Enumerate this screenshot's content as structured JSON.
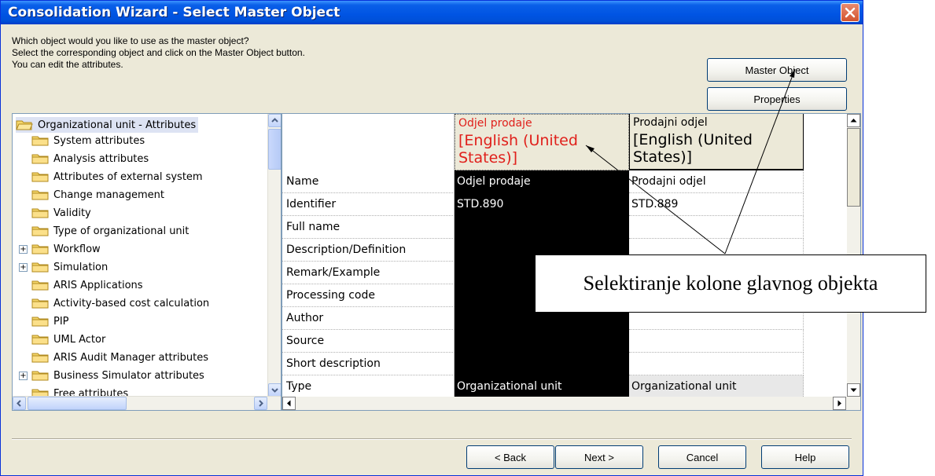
{
  "window": {
    "title": "Consolidation Wizard - Select Master Object"
  },
  "intro": {
    "line1": "Which object would you like to use as the master object?",
    "line2": "Select the corresponding object and click on the Master Object button.",
    "line3": "You can edit the attributes."
  },
  "buttons": {
    "master_object": "Master Object",
    "properties": "Properties",
    "back": "< Back",
    "next": "Next >",
    "cancel": "Cancel",
    "help": "Help"
  },
  "tree": {
    "root": "Organizational unit - Attributes",
    "items": [
      {
        "label": "System attributes",
        "expandable": false
      },
      {
        "label": "Analysis attributes",
        "expandable": false
      },
      {
        "label": "Attributes of external system",
        "expandable": false
      },
      {
        "label": "Change management",
        "expandable": false
      },
      {
        "label": "Validity",
        "expandable": false
      },
      {
        "label": "Type of organizational unit",
        "expandable": false
      },
      {
        "label": "Workflow",
        "expandable": true
      },
      {
        "label": "Simulation",
        "expandable": true
      },
      {
        "label": "ARIS Applications",
        "expandable": false
      },
      {
        "label": "Activity-based cost calculation",
        "expandable": false
      },
      {
        "label": "PIP",
        "expandable": false
      },
      {
        "label": "UML Actor",
        "expandable": false
      },
      {
        "label": "ARIS Audit Manager attributes",
        "expandable": false
      },
      {
        "label": "Business Simulator attributes",
        "expandable": true
      },
      {
        "label": "Free attributes",
        "expandable": false
      }
    ]
  },
  "grid": {
    "columns": [
      {
        "name": "Odjel prodaje",
        "lang": "[English (United States)]",
        "header_color": "#e0201b"
      },
      {
        "name": "Prodajni odjel",
        "lang": "[English (United States)]",
        "header_color": "#000000"
      }
    ],
    "rows": [
      {
        "label": "Name",
        "master": "Odjel prodaje",
        "other": "Prodajni odjel"
      },
      {
        "label": "Identifier",
        "master": "STD.890",
        "other": "STD.889"
      },
      {
        "label": "Full name",
        "master": "",
        "other": ""
      },
      {
        "label": "Description/Definition",
        "master": "",
        "other": ""
      },
      {
        "label": "Remark/Example",
        "master": "",
        "other": ""
      },
      {
        "label": "Processing code",
        "master": "",
        "other": ""
      },
      {
        "label": "Author",
        "master": "",
        "other": ""
      },
      {
        "label": "Source",
        "master": "",
        "other": ""
      },
      {
        "label": "Short description",
        "master": "",
        "other": ""
      },
      {
        "label": "Type",
        "master": "Organizational unit",
        "other": "Organizational unit"
      }
    ]
  },
  "annotation": {
    "text": "Selektiranje kolone glavnog objekta"
  },
  "colors": {
    "title_bar": "#0054e3",
    "dialog_bg": "#ece9d8",
    "master_column": "#000000",
    "folder": "#f5d66b"
  }
}
